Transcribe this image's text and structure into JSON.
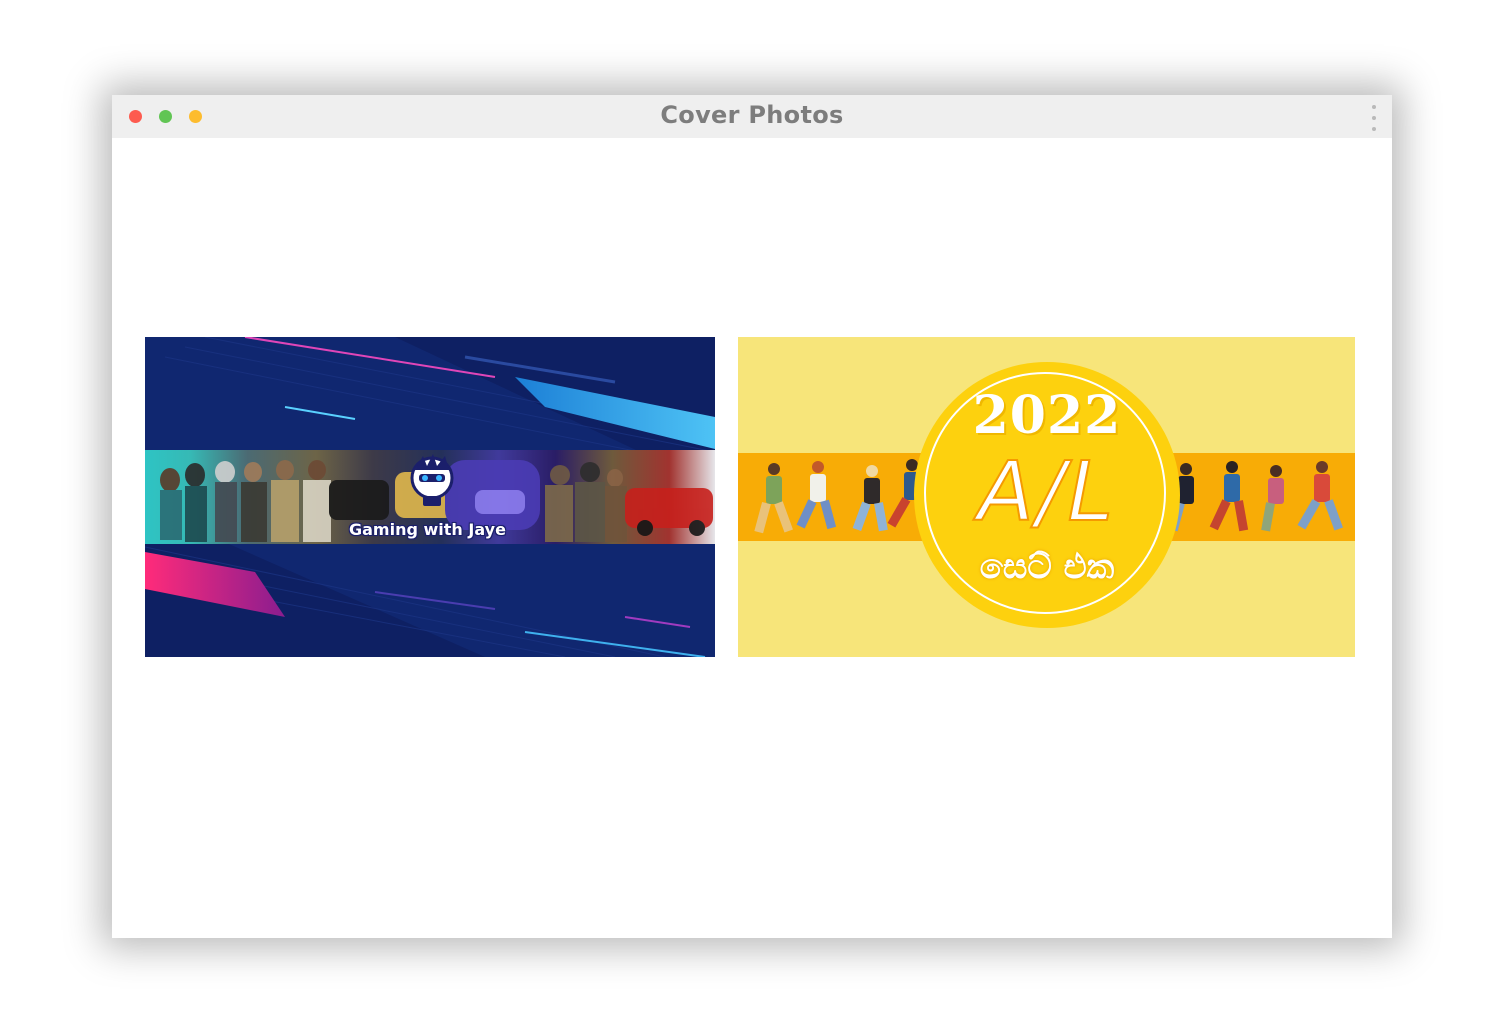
{
  "window": {
    "title": "Cover Photos",
    "traffic_lights": {
      "close_color": "#fd5b4f",
      "minimize_color": "#61c554",
      "zoom_color": "#fdbc2e"
    },
    "menu_icon": "kebab-menu-icon"
  },
  "covers": [
    {
      "id": "gaming",
      "text": "Gaming with Jaye",
      "colors": {
        "background": "#0e2063",
        "accent_blue": "#2aa8ee",
        "accent_pink": "#e0207a"
      }
    },
    {
      "id": "al",
      "year": "2022",
      "main_text": "A/L",
      "sub_text": "සෙට් එක",
      "colors": {
        "background": "#f7e57a",
        "band": "#f8ac06",
        "circle": "#fdd10e"
      }
    }
  ]
}
